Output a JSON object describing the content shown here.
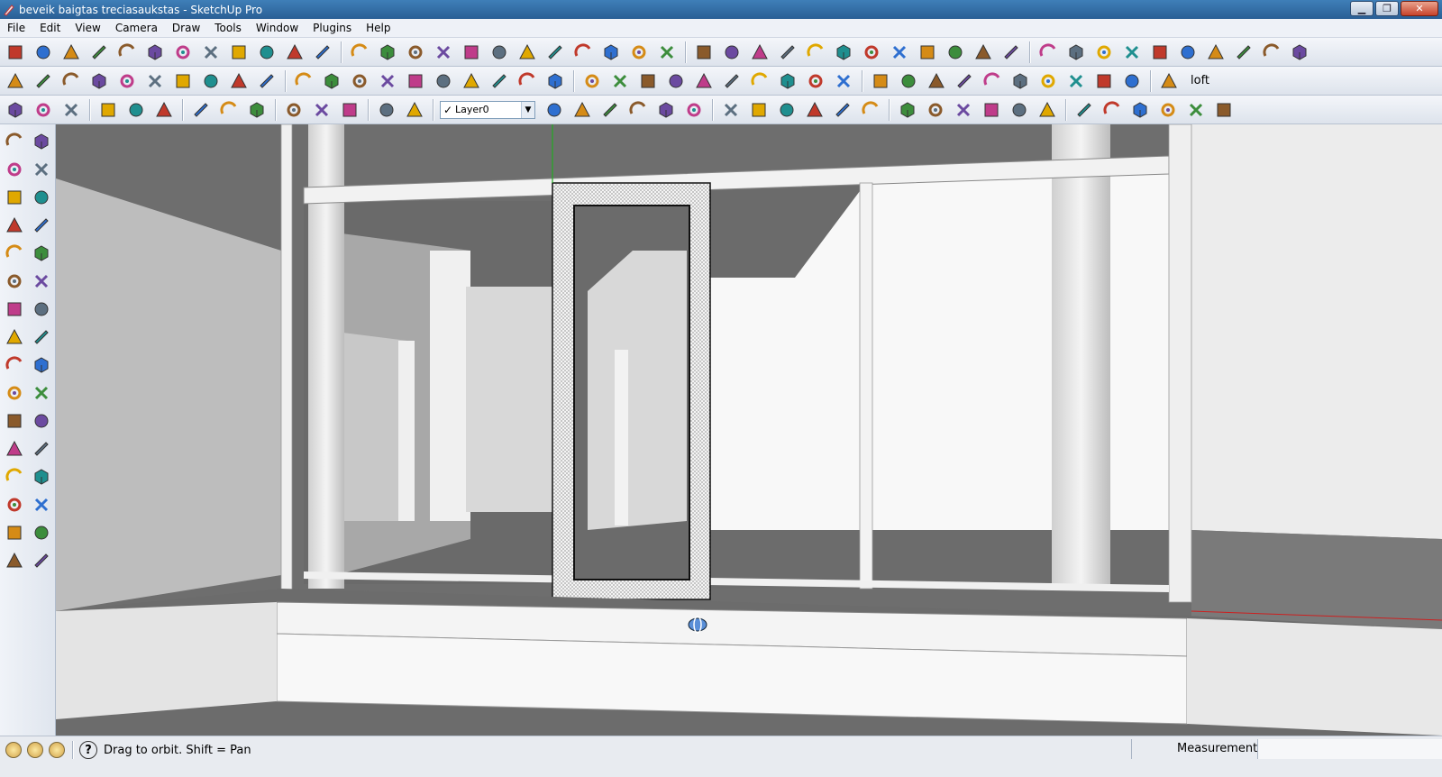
{
  "window": {
    "title": "beveik baigtas treciasaukstas - SketchUp Pro"
  },
  "menu": [
    "File",
    "Edit",
    "View",
    "Camera",
    "Draw",
    "Tools",
    "Window",
    "Plugins",
    "Help"
  ],
  "toolbar": {
    "row1": [
      "select-icon",
      "pencil-icon",
      "rectangle-icon",
      "circle-icon",
      "arc-icon",
      "push-pull-icon",
      "eraser-icon",
      "tape-measure-icon",
      "paint-bucket-icon",
      "push-pull-icon",
      "move-icon",
      "rotate-icon",
      "follow-me-icon",
      "orbit-icon",
      "pan-icon",
      "zoom-icon",
      "zoom-extents-icon",
      "previous-view-icon",
      "next-view-icon",
      "component-icon",
      "walk-icon",
      "google-earth-icon",
      "get-models-icon",
      "share-model-icon",
      "add-location-icon",
      "terrain-icon",
      "sandbox-icon",
      "smoove-icon",
      "stamp-icon",
      "drape-icon",
      "add-detail-icon",
      "flip-edge-icon",
      "eye-icon",
      "shadow-icon",
      "fog-icon",
      "section-icon",
      "pencil-icon",
      "dimension-icon",
      "protractor-icon",
      "text-icon",
      "axes-icon",
      "3d-text-icon",
      "fillet-icon",
      "chamfer-icon",
      "weld-icon",
      "shape-bender-icon",
      "joint-push-pull-icon",
      "curve-icon"
    ],
    "row2": [
      "geo-icon",
      "tag-icon",
      "registered-icon",
      "help-icon",
      "paint-tag-icon",
      "sphere-icon",
      "cone-icon",
      "flag-icon",
      "box-icon",
      "sphere-wire-icon",
      "scissors-icon",
      "cube-icon",
      "wireframe-cube-icon",
      "xray-cube-icon",
      "monochrome-icon",
      "hidden-line-icon",
      "shaded-icon",
      "textured-icon",
      "hand-icon",
      "lock-icon",
      "target-icon",
      "ring-icon",
      "globe-icon",
      "film-icon",
      "warehouse-icon",
      "style-icon",
      "delete-icon",
      "dimension-j-icon",
      "dimension-v-icon",
      "dimension-n-icon",
      "bend-icon",
      "twist-icon",
      "section-plane-icon",
      "node-icon",
      "star-icon",
      "tree-icon",
      "plant-icon",
      "cactus-icon",
      "arch-icon",
      "bridge-icon",
      "ruler-icon"
    ],
    "loft_label": "loft",
    "row3": [
      "zoom-window-icon",
      "zoom-select-icon",
      "fit-icon",
      "roof-icon",
      "t-beam-icon",
      "i-beam-icon",
      "hip-roof-icon",
      "gable-icon",
      "frame-icon",
      "dome-icon",
      "vault-icon",
      "stairs-icon",
      "bonus-icon",
      "tools-icon"
    ],
    "layer": {
      "name": "Layer0"
    },
    "row3b": [
      "layer-manager-icon",
      "color-by-layer-icon",
      "section-fill-icon",
      "arrows-up-icon",
      "arrows-down-icon",
      "align-icon",
      "intersect-icon",
      "rotate-left-icon",
      "rotate-right-icon",
      "pin-icon",
      "iso-view-icon",
      "top-view-icon",
      "front-view-icon",
      "right-view-icon",
      "back-view-icon",
      "left-view-icon",
      "red-cut-icon",
      "blue-cut-icon",
      "green-cut-icon",
      "marker-icon",
      "flag-cut-icon",
      "hammer-icon",
      "gear-sun-icon",
      "wrench-icon"
    ]
  },
  "left_tools": [
    "select-icon",
    "component-icon",
    "paint-bucket-icon",
    "eraser-icon",
    "rectangle-icon",
    "pencil-icon",
    "circle-icon",
    "arc-icon",
    "polygon-icon",
    "freehand-icon",
    "move-icon",
    "push-pull-icon",
    "rotate-icon",
    "follow-me-icon",
    "scale-icon",
    "offset-icon",
    "tape-measure-icon",
    "dimension-icon",
    "protractor-icon",
    "text-icon",
    "axes-icon",
    "3d-text-icon",
    "orbit-icon",
    "pan-icon",
    "zoom-icon",
    "zoom-window-icon",
    "zoom-extents-icon",
    "previous-icon",
    "position-camera-icon",
    "look-around-icon",
    "walk-icon",
    "section-plane-icon"
  ],
  "status": {
    "icons": [
      "geo-location-icon",
      "credits-icon",
      "user-icon"
    ],
    "message": "Drag to orbit.  Shift = Pan",
    "measurements_label": "Measurements",
    "measurements_value": ""
  },
  "colors": {
    "title_bar": "#2f6aa3",
    "toolbar_bg": "#e4e9f0",
    "viewport_bg": "#6f6f6f",
    "axis_green": "#22aa22",
    "axis_blue": "#2020cc",
    "axis_red": "#cc2020"
  }
}
